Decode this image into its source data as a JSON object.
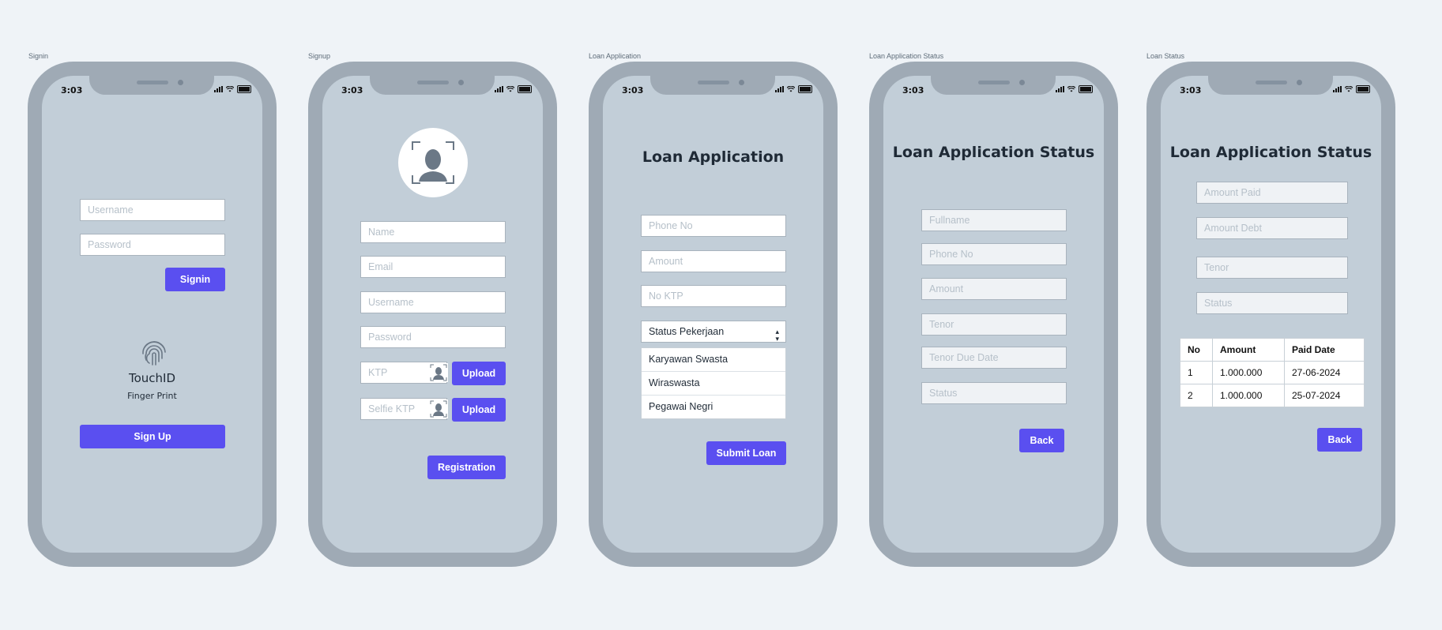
{
  "frames": {
    "signin": {
      "label": "Signin",
      "time": "3:03",
      "username_placeholder": "Username",
      "password_placeholder": "Password",
      "signin_label": "Signin",
      "touchid_label": "TouchID",
      "fingerprint_label": "Finger Print",
      "signup_label": "Sign Up"
    },
    "signup": {
      "label": "Signup",
      "time": "3:03",
      "name_placeholder": "Name",
      "email_placeholder": "Email",
      "username_placeholder": "Username",
      "password_placeholder": "Password",
      "ktp_placeholder": "KTP",
      "selfie_placeholder": "Selfie KTP",
      "upload_label": "Upload",
      "registration_label": "Registration"
    },
    "loan_application": {
      "label": "Loan Application",
      "time": "3:03",
      "title": "Loan Application",
      "phone_placeholder": "Phone No",
      "amount_placeholder": "Amount",
      "ktp_placeholder": "No KTP",
      "status_select_value": "Status Pekerjaan",
      "options": [
        "Karyawan Swasta",
        "Wiraswasta",
        "Pegawai Negri"
      ],
      "submit_label": "Submit Loan"
    },
    "loan_application_status": {
      "label": "Loan Application Status",
      "time": "3:03",
      "title": "Loan Application Status",
      "fullname_placeholder": "Fullname",
      "phone_placeholder": "Phone No",
      "amount_placeholder": "Amount",
      "tenor_placeholder": "Tenor",
      "due_date_placeholder": "Tenor Due Date",
      "status_placeholder": "Status",
      "back_label": "Back"
    },
    "loan_status": {
      "label": "Loan Status",
      "time": "3:03",
      "title": "Loan Application Status",
      "amount_paid_placeholder": "Amount Paid",
      "amount_debt_placeholder": "Amount Debt",
      "tenor_placeholder": "Tenor",
      "status_placeholder": "Status",
      "table_headers": [
        "No",
        "Amount",
        "Paid Date"
      ],
      "rows": [
        [
          "1",
          "1.000.000",
          "27-06-2024"
        ],
        [
          "2",
          "1.000.000",
          "25-07-2024"
        ]
      ],
      "back_label": "Back"
    }
  },
  "colors": {
    "background": "#eff3f7",
    "phone_frame": "#9faab5",
    "screen": "#c2ced8",
    "accent": "#5a4ff0"
  },
  "icons": [
    "signal-icon",
    "wifi-icon",
    "battery-icon",
    "fingerprint-icon",
    "avatar-placeholder-icon"
  ]
}
